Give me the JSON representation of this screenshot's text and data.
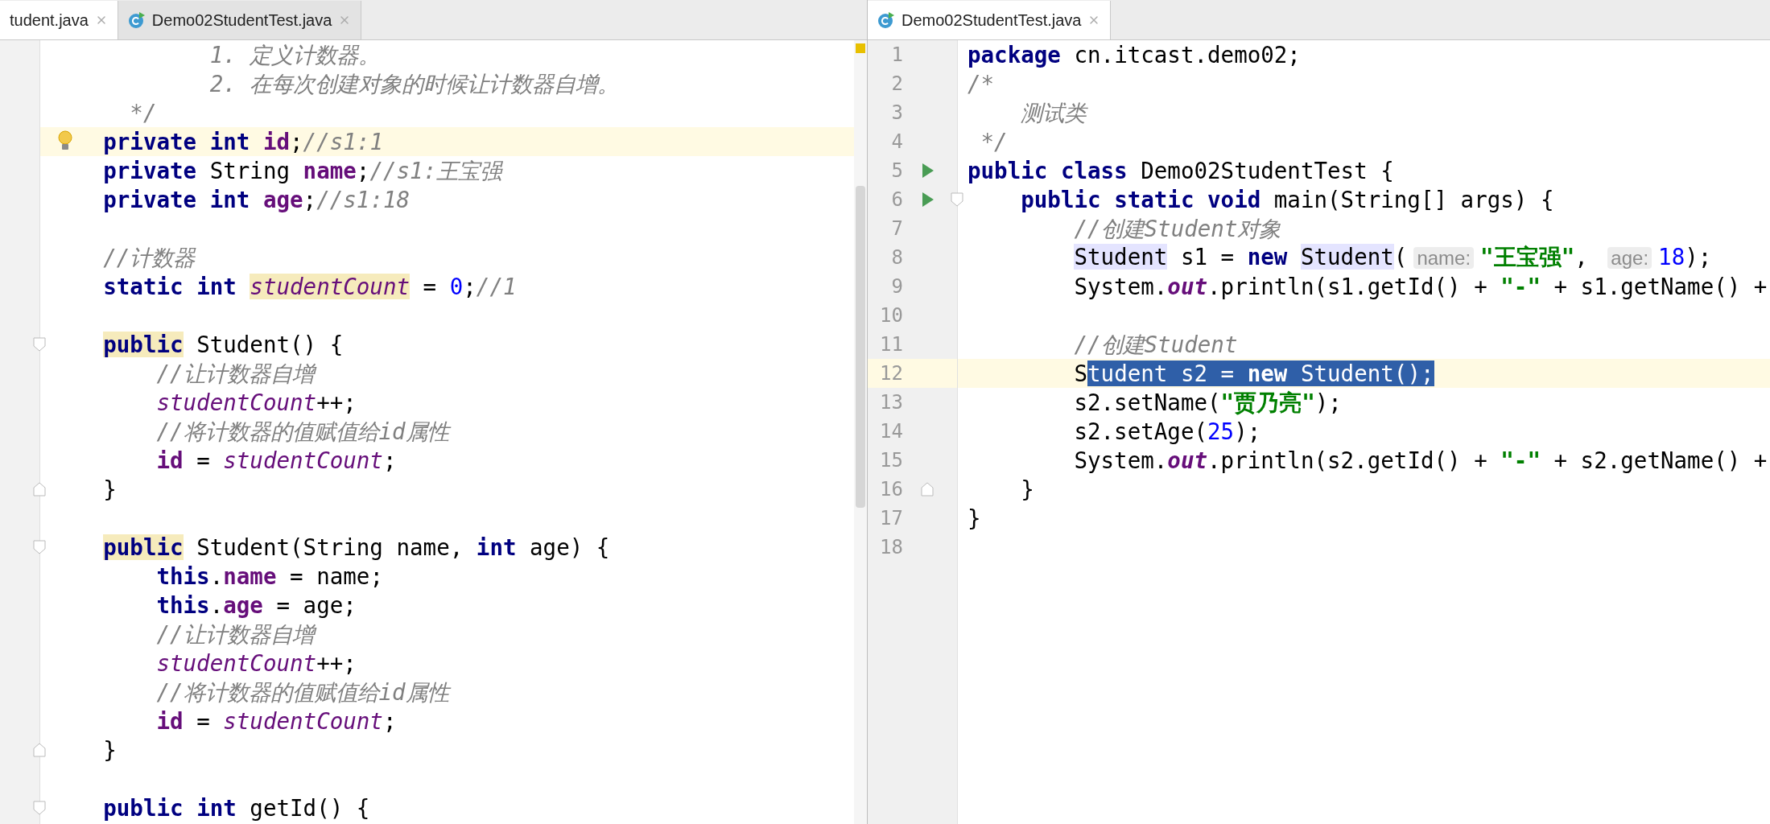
{
  "left_pane": {
    "tabs": [
      {
        "label": "tudent.java",
        "selected": true,
        "icon": false
      },
      {
        "label": "Demo02StudentTest.java",
        "selected": false,
        "icon": true
      }
    ],
    "lines": [
      {
        "current": false,
        "tokens": [
          {
            "text": "            1. 定义计数器。",
            "kind": "comment"
          }
        ]
      },
      {
        "current": false,
        "tokens": [
          {
            "text": "            2. 在每次创建对象的时候让计数器自增。",
            "kind": "comment"
          }
        ]
      },
      {
        "current": false,
        "tokens": [
          {
            "text": "      */",
            "kind": "comment"
          }
        ]
      },
      {
        "current": true,
        "gutter": [
          {
            "kind": "bulb"
          }
        ],
        "tokens": [
          {
            "text": "    private int",
            "kind": "keyword"
          },
          {
            "text": " id",
            "kind": "field"
          },
          {
            "text": ";",
            "kind": "plain"
          },
          {
            "text": "//s1:1",
            "kind": "comment"
          }
        ]
      },
      {
        "current": false,
        "tokens": [
          {
            "text": "    private",
            "kind": "keyword"
          },
          {
            "text": " String",
            "kind": "plain"
          },
          {
            "text": " name",
            "kind": "field"
          },
          {
            "text": ";",
            "kind": "plain"
          },
          {
            "text": "//s1:王宝强",
            "kind": "comment"
          }
        ]
      },
      {
        "current": false,
        "tokens": [
          {
            "text": "    private int",
            "kind": "keyword"
          },
          {
            "text": " age",
            "kind": "field"
          },
          {
            "text": ";",
            "kind": "plain"
          },
          {
            "text": "//s1:18",
            "kind": "comment"
          }
        ]
      },
      {
        "current": false
      },
      {
        "current": false,
        "tokens": [
          {
            "text": "    //计数器",
            "kind": "comment"
          }
        ]
      },
      {
        "current": false,
        "tokens": [
          {
            "text": "    static int ",
            "kind": "keyword"
          },
          {
            "text": "studentCount",
            "kind": "static_field",
            "color": "#f6ebbc"
          },
          {
            "text": " = ",
            "kind": "plain"
          },
          {
            "text": "0",
            "kind": "number"
          },
          {
            "text": ";",
            "kind": "plain"
          },
          {
            "text": "//1",
            "kind": "comment"
          }
        ]
      },
      {
        "current": false
      },
      {
        "current": false,
        "gutter": [
          {
            "kind": "fold_start"
          }
        ],
        "tokens": [
          {
            "text": "    public",
            "kind": "keyword",
            "color": "#f6ebbc"
          },
          {
            "text": " Student() {",
            "kind": "plain"
          }
        ]
      },
      {
        "current": false,
        "tokens": [
          {
            "text": "        //让计数器自增",
            "kind": "comment"
          }
        ]
      },
      {
        "current": false,
        "tokens": [
          {
            "text": "        studentCount",
            "kind": "static_field"
          },
          {
            "text": "++;",
            "kind": "plain"
          }
        ]
      },
      {
        "current": false,
        "tokens": [
          {
            "text": "        //将计数器的值赋值给id属性",
            "kind": "comment"
          }
        ]
      },
      {
        "current": false,
        "tokens": [
          {
            "text": "        id",
            "kind": "field"
          },
          {
            "text": " = ",
            "kind": "plain"
          },
          {
            "text": "studentCount",
            "kind": "static_field"
          },
          {
            "text": ";",
            "kind": "plain"
          }
        ]
      },
      {
        "current": false,
        "gutter": [
          {
            "kind": "fold_end"
          }
        ],
        "tokens": [
          {
            "text": "    }",
            "kind": "plain"
          }
        ]
      },
      {
        "current": false
      },
      {
        "current": false,
        "gutter": [
          {
            "kind": "fold_start"
          }
        ],
        "tokens": [
          {
            "text": "    public",
            "kind": "keyword",
            "color": "#f6ebbc"
          },
          {
            "text": " Student(String name, ",
            "kind": "plain"
          },
          {
            "text": "int",
            "kind": "keyword"
          },
          {
            "text": " age) {",
            "kind": "plain"
          }
        ]
      },
      {
        "current": false,
        "tokens": [
          {
            "text": "        this",
            "kind": "keyword"
          },
          {
            "text": ".",
            "kind": "plain"
          },
          {
            "text": "name",
            "kind": "field"
          },
          {
            "text": " = name;",
            "kind": "plain"
          }
        ]
      },
      {
        "current": false,
        "tokens": [
          {
            "text": "        this",
            "kind": "keyword"
          },
          {
            "text": ".",
            "kind": "plain"
          },
          {
            "text": "age",
            "kind": "field"
          },
          {
            "text": " = age;",
            "kind": "plain"
          }
        ]
      },
      {
        "current": false,
        "tokens": [
          {
            "text": "        //让计数器自增",
            "kind": "comment"
          }
        ]
      },
      {
        "current": false,
        "tokens": [
          {
            "text": "        studentCount",
            "kind": "static_field"
          },
          {
            "text": "++;",
            "kind": "plain"
          }
        ]
      },
      {
        "current": false,
        "tokens": [
          {
            "text": "        //将计数器的值赋值给id属性",
            "kind": "comment"
          }
        ]
      },
      {
        "current": false,
        "tokens": [
          {
            "text": "        id",
            "kind": "field"
          },
          {
            "text": " = ",
            "kind": "plain"
          },
          {
            "text": "studentCount",
            "kind": "static_field"
          },
          {
            "text": ";",
            "kind": "plain"
          }
        ]
      },
      {
        "current": false,
        "gutter": [
          {
            "kind": "fold_end"
          }
        ],
        "tokens": [
          {
            "text": "    }",
            "kind": "plain"
          }
        ]
      },
      {
        "current": false
      },
      {
        "current": false,
        "gutter": [
          {
            "kind": "fold_start"
          }
        ],
        "tokens": [
          {
            "text": "    public int",
            "kind": "keyword"
          },
          {
            "text": " getId() {",
            "kind": "plain"
          }
        ]
      }
    ]
  },
  "right_pane": {
    "tabs": [
      {
        "label": "Demo02StudentTest.java",
        "selected": true,
        "icon": true
      }
    ],
    "lines": [
      {
        "number": "1",
        "current": false,
        "tokens": [
          {
            "text": "package",
            "kind": "keyword"
          },
          {
            "text": " cn.itcast.demo02;",
            "kind": "plain"
          }
        ]
      },
      {
        "number": "2",
        "current": false,
        "tokens": [
          {
            "text": "/*",
            "kind": "comment"
          }
        ]
      },
      {
        "number": "3",
        "current": false,
        "tokens": [
          {
            "text": "    测试类",
            "kind": "comment"
          }
        ]
      },
      {
        "number": "4",
        "current": false,
        "tokens": [
          {
            "text": " */",
            "kind": "comment"
          }
        ]
      },
      {
        "number": "5",
        "current": false,
        "gutter": [
          {
            "kind": "run"
          }
        ],
        "tokens": [
          {
            "text": "public class",
            "kind": "keyword"
          },
          {
            "text": " Demo02StudentTest {",
            "kind": "plain"
          }
        ]
      },
      {
        "number": "6",
        "current": false,
        "gutter": [
          {
            "kind": "run"
          },
          {
            "kind": "fold_start"
          }
        ],
        "tokens": [
          {
            "text": "    public static void",
            "kind": "keyword"
          },
          {
            "text": " main(String[] args) {",
            "kind": "plain"
          }
        ]
      },
      {
        "number": "7",
        "current": false,
        "tokens": [
          {
            "text": "        //创建Student对象",
            "kind": "comment"
          }
        ]
      },
      {
        "number": "8",
        "current": false,
        "tokens": [
          {
            "text": "        Student",
            "kind": "plain",
            "color": "#e4e4ff"
          },
          {
            "text": " s1 = ",
            "kind": "plain"
          },
          {
            "text": "new ",
            "kind": "keyword"
          },
          {
            "text": "Student",
            "kind": "plain",
            "color": "#e4e4ff"
          },
          {
            "text": "(",
            "kind": "plain"
          },
          {
            "text": "name:",
            "kind": "hint"
          },
          {
            "text": "\"王宝强\"",
            "kind": "string"
          },
          {
            "text": ", ",
            "kind": "plain"
          },
          {
            "text": "age:",
            "kind": "hint"
          },
          {
            "text": "18",
            "kind": "number"
          },
          {
            "text": ");",
            "kind": "plain"
          }
        ]
      },
      {
        "number": "9",
        "current": false,
        "tokens": [
          {
            "text": "        System.",
            "kind": "plain"
          },
          {
            "text": "out",
            "kind": "static_field_bold"
          },
          {
            "text": ".println(s1.getId() + ",
            "kind": "plain"
          },
          {
            "text": "\"-\"",
            "kind": "string"
          },
          {
            "text": " + s1.getName() +",
            "kind": "plain"
          }
        ]
      },
      {
        "number": "10",
        "current": false
      },
      {
        "number": "11",
        "current": false,
        "tokens": [
          {
            "text": "        //创建Student",
            "kind": "comment"
          }
        ]
      },
      {
        "number": "12",
        "current": true,
        "tokens": [
          {
            "text": "        S",
            "kind": "plain"
          },
          {
            "text": "tudent s2 = ",
            "kind": "selected"
          },
          {
            "text": "new",
            "kind": "selected_keyword"
          },
          {
            "text": " Student();",
            "kind": "selected"
          }
        ]
      },
      {
        "number": "13",
        "current": false,
        "tokens": [
          {
            "text": "        s2.setName(",
            "kind": "plain"
          },
          {
            "text": "\"贾乃亮\"",
            "kind": "string"
          },
          {
            "text": ");",
            "kind": "plain"
          }
        ]
      },
      {
        "number": "14",
        "current": false,
        "tokens": [
          {
            "text": "        s2.setAge(",
            "kind": "plain"
          },
          {
            "text": "25",
            "kind": "number"
          },
          {
            "text": ");",
            "kind": "plain"
          }
        ]
      },
      {
        "number": "15",
        "current": false,
        "tokens": [
          {
            "text": "        System.",
            "kind": "plain"
          },
          {
            "text": "out",
            "kind": "static_field_bold"
          },
          {
            "text": ".println(s2.getId() + ",
            "kind": "plain"
          },
          {
            "text": "\"-\"",
            "kind": "string"
          },
          {
            "text": " + s2.getName() +",
            "kind": "plain"
          }
        ]
      },
      {
        "number": "16",
        "current": false,
        "gutter": [
          {
            "kind": "fold_end"
          }
        ],
        "tokens": [
          {
            "text": "    }",
            "kind": "plain"
          }
        ]
      },
      {
        "number": "17",
        "current": false,
        "tokens": [
          {
            "text": "}",
            "kind": "plain"
          }
        ]
      },
      {
        "number": "18",
        "current": false
      }
    ]
  }
}
